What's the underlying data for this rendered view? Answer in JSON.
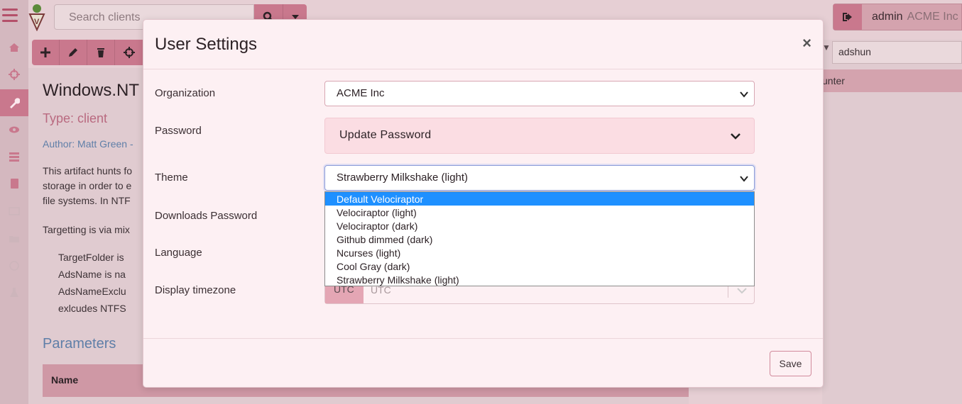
{
  "app": {
    "search_placeholder": "Search clients",
    "user_name": "admin",
    "user_org": "ACME Inc",
    "right_input": "adshun",
    "right_row": "unter"
  },
  "artifact": {
    "title": "Windows.NT",
    "type": "Type: client",
    "author": "Author: Matt Green -",
    "desc_lines": [
      "This artifact hunts fo",
      "storage in order to e",
      "file systems. In NTF"
    ],
    "targetting": "Targetting is via mix",
    "bullets": [
      "TargetFolder is",
      "AdsName is na",
      "AdsNameExclu",
      "exlcudes NTFS"
    ],
    "params_heading": "Parameters",
    "table_header_name": "Name"
  },
  "modal": {
    "title": "User Settings",
    "close": "×",
    "labels": {
      "organization": "Organization",
      "password": "Password",
      "theme": "Theme",
      "downloads_password": "Downloads Password",
      "language": "Language",
      "timezone": "Display timezone"
    },
    "organization_value": "ACME Inc",
    "password_toggle": "Update Password",
    "theme_value": "Strawberry Milkshake (light)",
    "timezone_prefix": "UTC",
    "timezone_value": "UTC",
    "save": "Save",
    "theme_options": [
      "Default Velociraptor",
      "Velociraptor (light)",
      "Velociraptor (dark)",
      "Github dimmed (dark)",
      "Ncurses (light)",
      "Cool Gray (dark)",
      "Strawberry Milkshake (light)"
    ],
    "theme_highlighted": "Default Velociraptor"
  },
  "colors": {
    "accent": "#c9788d",
    "highlight": "#1e90ff"
  }
}
